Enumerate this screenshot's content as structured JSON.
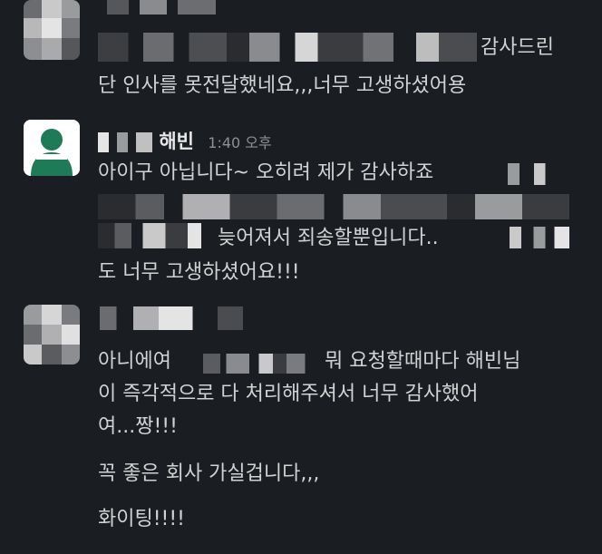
{
  "messages": [
    {
      "author": "",
      "time": "",
      "lines": [
        "감사드린",
        "단 인사를 못전달했네요,,,너무 고생하셨어용"
      ]
    },
    {
      "author": "해빈",
      "time": "1:40 오후",
      "lines": [
        "아이구 아닙니다~ 오히려 제가 감사하죠",
        "늦어져서 죄송할뿐입니다..",
        "도 너무 고생하셨어요!!!"
      ]
    },
    {
      "author": "",
      "time": "",
      "lines": [
        "아니에여",
        "뭐 요청할때마다 해빈님",
        "이 즉각적으로 다 처리해주셔서 너무 감사했어",
        "여...짱!!!",
        "꼭 좋은 회사 가실겁니다,,,",
        "화이팅!!!!"
      ]
    }
  ],
  "colors": {
    "background": "#1a1d21",
    "text": "#d1d2d3",
    "timestamp": "#8e9094",
    "avatar_green": "#1f7a57"
  },
  "icons": {
    "avatar_2": "user-silhouette-icon"
  }
}
